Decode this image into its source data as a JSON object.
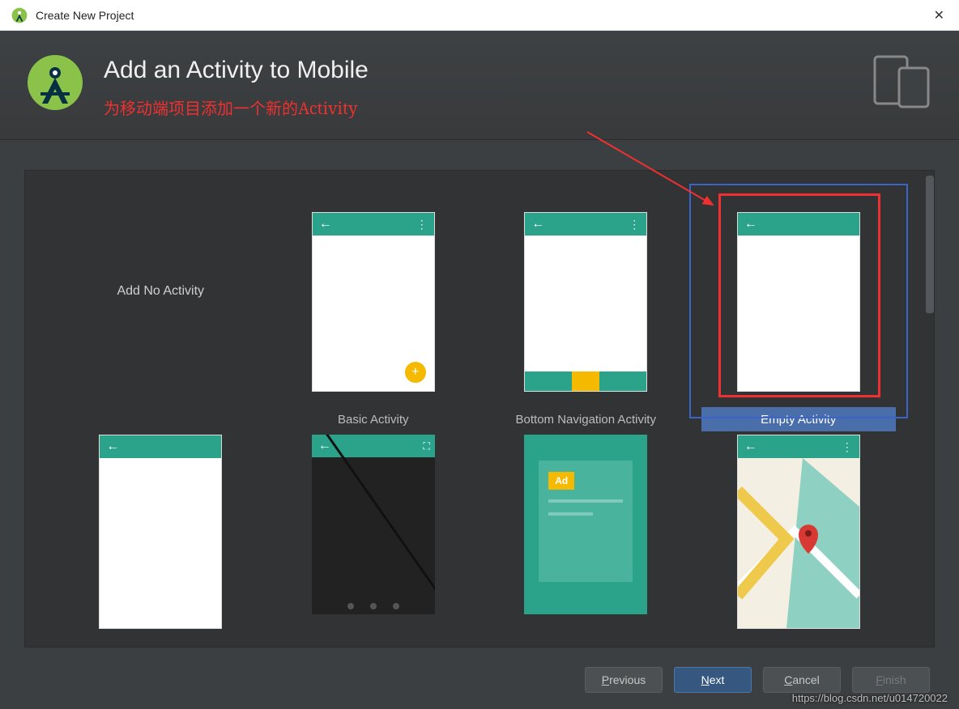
{
  "titlebar": {
    "title": "Create New Project"
  },
  "header": {
    "heading": "Add an Activity to Mobile",
    "subtitle_annotation": "为移动端项目添加一个新的Activity"
  },
  "templates": {
    "no_activity_label": "Add No Activity",
    "basic": "Basic Activity",
    "bottom_nav": "Bottom Navigation Activity",
    "empty": "Empty Activity",
    "ad_badge": "Ad"
  },
  "buttons": {
    "previous": "Previous",
    "previous_u": "P",
    "next": "Next",
    "next_u": "N",
    "cancel": "Cancel",
    "cancel_u": "C",
    "finish": "Finish",
    "finish_u": "F"
  },
  "watermark": "https://blog.csdn.net/u014720022"
}
